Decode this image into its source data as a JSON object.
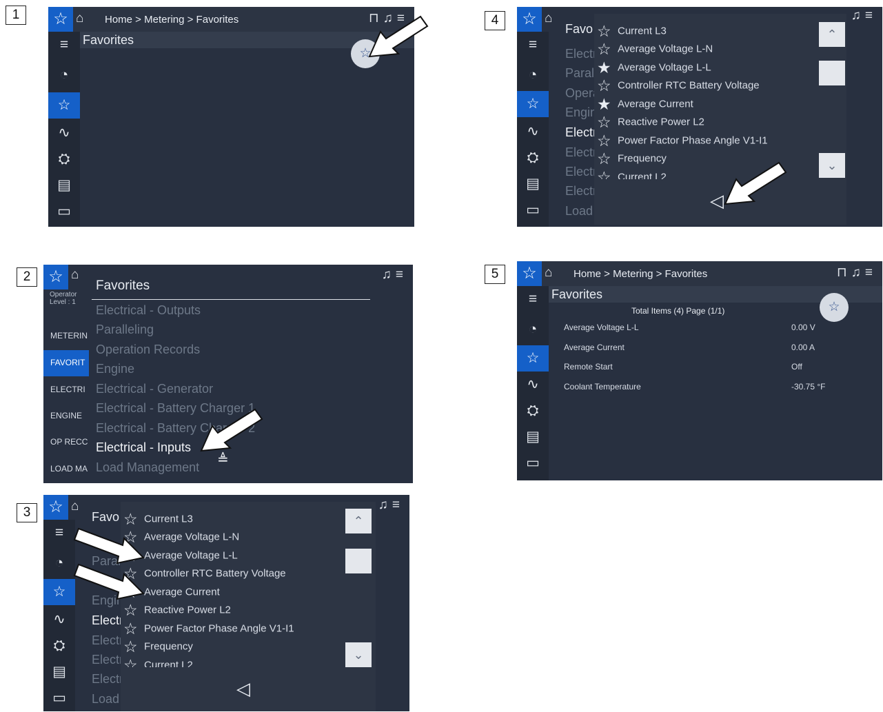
{
  "steps": [
    "1",
    "2",
    "3",
    "4",
    "5"
  ],
  "breadcrumb": "Home > Metering > Favorites",
  "favorites_title": "Favorites",
  "favorites_short": "Favo",
  "operator": {
    "role": "Operator",
    "level": "Level : 1"
  },
  "side_labels": [
    "METERIN",
    "FAVORIT",
    "ELECTRI",
    "ENGINE",
    "OP RECC",
    "LOAD MA"
  ],
  "menu_items": [
    "Electrical - Outputs",
    "Paralleling",
    "Operation Records",
    "Engine",
    "Electrical - Generator",
    "Electrical - Battery Charger 1",
    "Electrical - Battery Charger 2",
    "Electrical - Inputs",
    "Load Management"
  ],
  "bg_items": [
    "Electr",
    "Paral",
    "Opera",
    "Engin",
    "Electr",
    "Electr",
    "Electr",
    "Electr",
    "Load"
  ],
  "param_items": [
    {
      "label": "Current L3",
      "starred": false
    },
    {
      "label": "Average Voltage L-N",
      "starred": false
    },
    {
      "label": "Average Voltage L-L",
      "starred": true
    },
    {
      "label": "Controller RTC Battery Voltage",
      "starred": false
    },
    {
      "label": "Average Current",
      "starred": true
    },
    {
      "label": "Reactive Power L2",
      "starred": false
    },
    {
      "label": "Power Factor Phase Angle V1-I1",
      "starred": false
    },
    {
      "label": "Frequency",
      "starred": false
    },
    {
      "label": "Current L2",
      "starred": false
    }
  ],
  "result": {
    "summary": "Total Items (4) Page (1/1)",
    "rows": [
      {
        "label": "Average Voltage L-L",
        "value": "0.00 V"
      },
      {
        "label": "Average Current",
        "value": "0.00 A"
      },
      {
        "label": "Remote Start",
        "value": "Off"
      },
      {
        "label": "Coolant Temperature",
        "value": "-30.75 °F"
      }
    ]
  },
  "icons": {
    "star_outline": "☆",
    "star_filled": "★",
    "home": "⌂",
    "chevron_up": "⌃",
    "chevron_down": "⌄",
    "back": "◁",
    "colors": {
      "screen": "#283040",
      "accent": "#1560c8",
      "popup": "#2d3544"
    }
  }
}
